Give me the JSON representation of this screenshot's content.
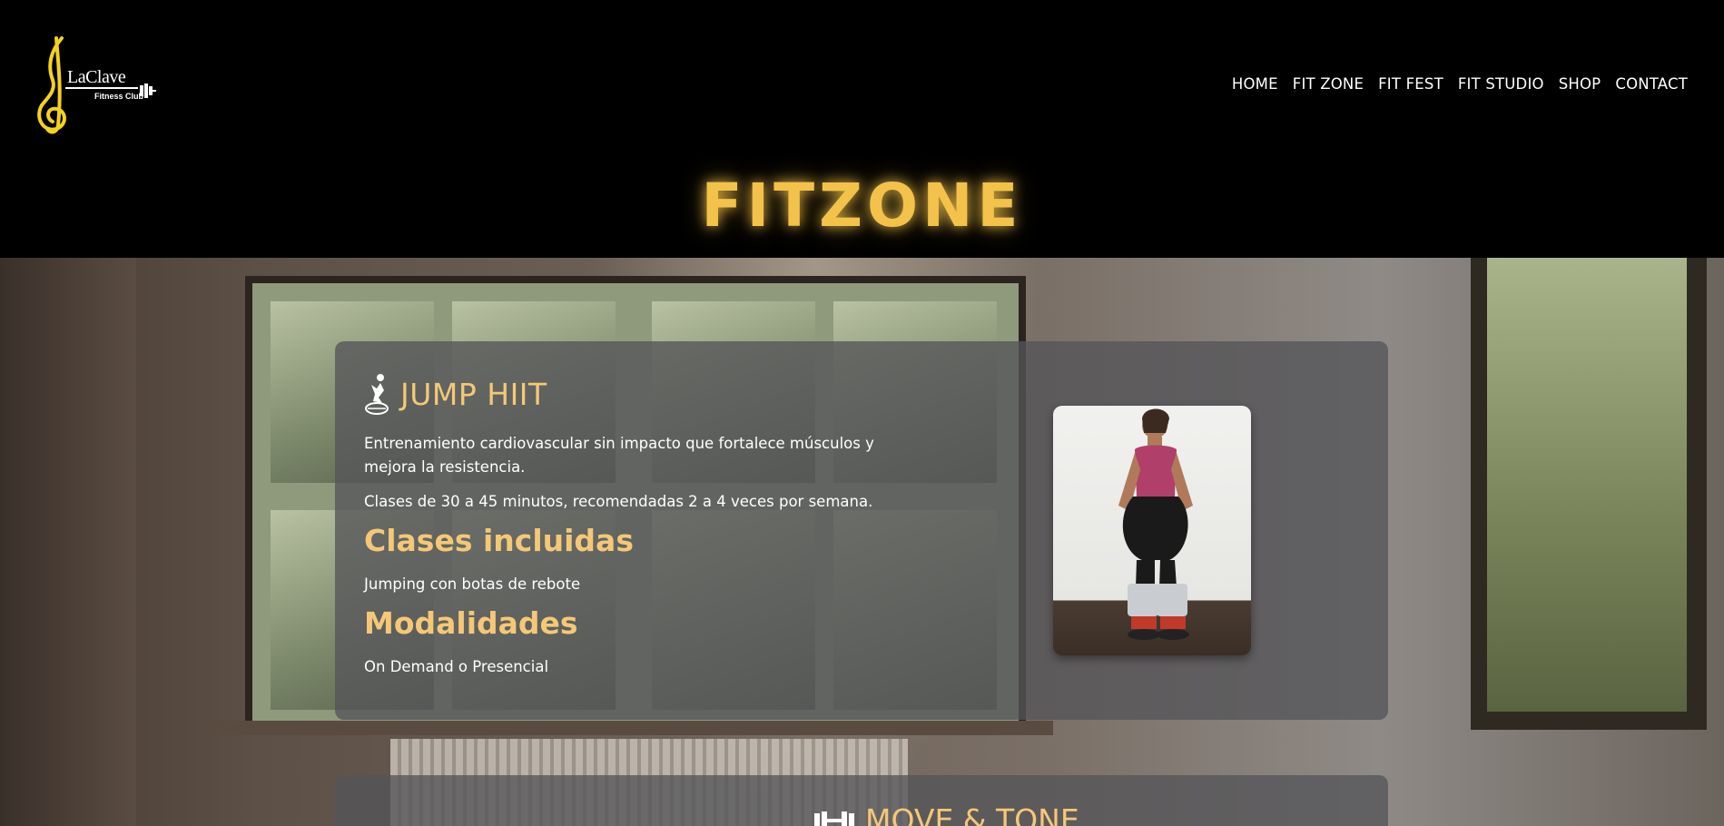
{
  "header": {
    "logo": {
      "brand": "LaClave",
      "subtitle": "Fitness Club",
      "accent_color": "#f5d21a"
    },
    "nav": [
      "HOME",
      "FIT ZONE",
      "FIT FEST",
      "FIT STUDIO",
      "SHOP",
      "CONTACT"
    ]
  },
  "page_title": "FITZONE",
  "colors": {
    "title_glow": "#f3c24a",
    "heading": "#f5c877",
    "card_bg": "rgba(85,85,88,0.78)"
  },
  "cards": [
    {
      "icon": "jumping-person-icon",
      "title": "JUMP HIIT",
      "description_1": "Entrenamiento cardiovascular sin impacto que fortalece músculos y mejora la resistencia.",
      "description_2": "Clases de 30 a 45 minutos, recomendadas 2 a 4 veces por semana.",
      "classes_heading": "Clases incluidas",
      "classes": "Jumping con botas de rebote",
      "modes_heading": "Modalidades",
      "modes": "On Demand o Presencial",
      "photo": "instructor-photo"
    },
    {
      "icon": "dumbbell-icon",
      "title": "MOVE & TONE"
    }
  ]
}
